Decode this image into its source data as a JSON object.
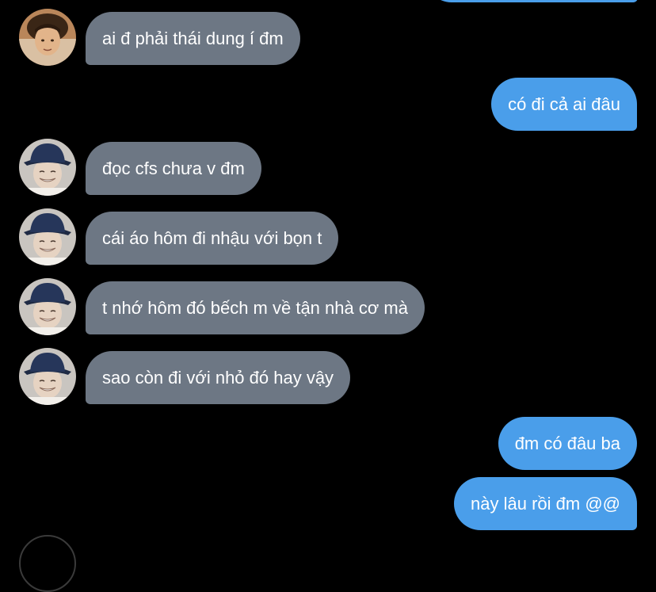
{
  "conversation": {
    "messages": [
      {
        "id": "m1",
        "direction": "incoming",
        "text": "ai đ phải thái dung í đm",
        "avatar_icon": "user-photo-avatar-warm"
      },
      {
        "id": "m2",
        "direction": "outgoing",
        "text": "có đi cả ai đâu"
      },
      {
        "id": "m3",
        "direction": "incoming",
        "text": "đọc cfs chưa v đm",
        "avatar_icon": "user-photo-avatar-bucket-hat"
      },
      {
        "id": "m4",
        "direction": "incoming",
        "text": "cái áo hôm đi nhậu với bọn t",
        "avatar_icon": "user-photo-avatar-bucket-hat"
      },
      {
        "id": "m5",
        "direction": "incoming",
        "text": "t nhớ hôm đó bếch m về tận nhà cơ mà",
        "avatar_icon": "user-photo-avatar-bucket-hat"
      },
      {
        "id": "m6",
        "direction": "incoming",
        "text": "sao còn đi với nhỏ đó hay vậy",
        "avatar_icon": "user-photo-avatar-bucket-hat"
      },
      {
        "id": "m7",
        "direction": "outgoing",
        "text": "đm có đâu ba"
      },
      {
        "id": "m8",
        "direction": "outgoing",
        "text": "này lâu rồi đm @@"
      }
    ]
  },
  "colors": {
    "background": "#000000",
    "incoming_bubble": "#6d7784",
    "outgoing_bubble": "#4a9eea",
    "bubble_text": "#ffffff"
  }
}
